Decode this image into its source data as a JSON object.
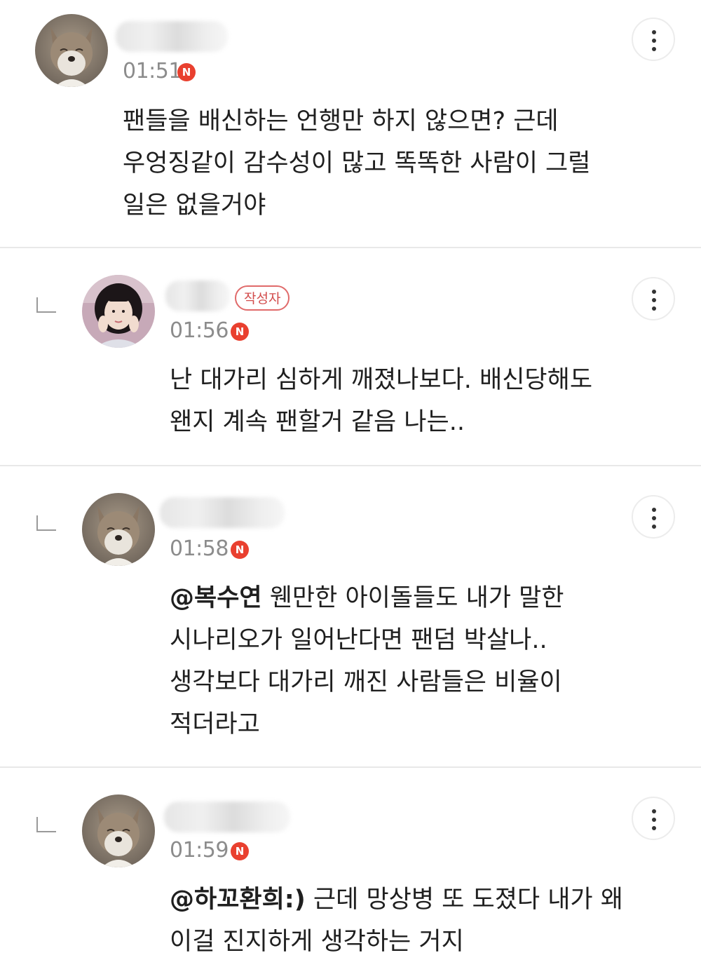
{
  "comments": [
    {
      "time": "01:51",
      "new_badge": "N",
      "lines": [
        "팬들을 배신하는 언행만 하지 않으면? 근데",
        "우엉징같이 감수성이 많고 똑똑한 사람이 그럴",
        "일은 없을거야"
      ]
    },
    {
      "author_badge": "작성자",
      "time": "01:56",
      "new_badge": "N",
      "lines": [
        "난 대가리 심하게 깨졌나보다. 배신당해도",
        "왠지 계속 팬할거 같음 나는.."
      ]
    },
    {
      "time": "01:58",
      "new_badge": "N",
      "mention": "@복수연",
      "lines": [
        " 웬만한 아이돌들도 내가 말한",
        "시나리오가 일어난다면 팬덤 박살나..",
        "생각보다 대가리 깨진 사람들은 비율이",
        "적더라고"
      ]
    },
    {
      "time": "01:59",
      "new_badge": "N",
      "mention": "@하꼬환희:)",
      "lines": [
        " 근데 망상병 또 도졌다 내가 왜",
        "이걸 진지하게 생각하는 거지"
      ]
    }
  ],
  "icons": {
    "reply": "reply-arrow-icon",
    "more": "more-vertical-icon",
    "new": "new-badge-icon"
  },
  "colors": {
    "new_badge": "#e9402f",
    "author_badge": "#d24c4c",
    "time": "#8c8c8c",
    "divider": "#e8e8e8"
  }
}
